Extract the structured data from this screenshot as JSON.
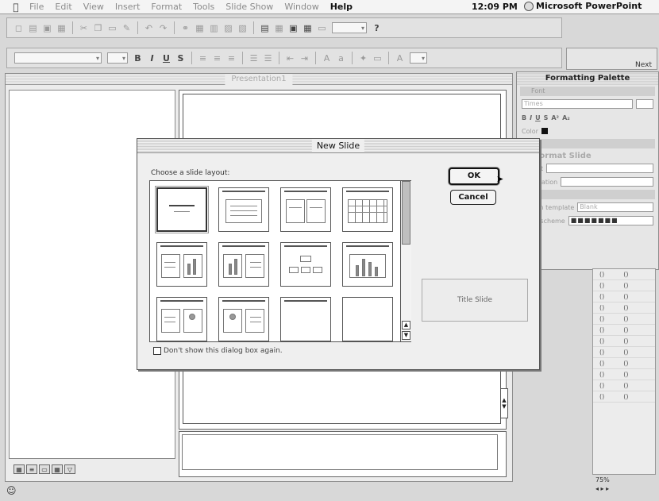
{
  "menubar": {
    "apple": "",
    "items": [
      "File",
      "Edit",
      "View",
      "Insert",
      "Format",
      "Tools",
      "Slide Show",
      "Window",
      "Help"
    ],
    "clock": "12:09 PM",
    "app_name": "Microsoft PowerPoint"
  },
  "document": {
    "title": "Presentation1"
  },
  "palette": {
    "title": "Formatting Palette",
    "font_section": "Font",
    "font_name": "Times",
    "color_label": "Color",
    "placement_heading": "Format Slide",
    "layout_label": "Layout",
    "orientation_label": "Orientation",
    "design_template_label": "Design template",
    "design_template_value": "Blank",
    "color_scheme_label": "Color scheme"
  },
  "next_button": "Next",
  "zoom": "75%",
  "dialog": {
    "title": "New Slide",
    "choose_label": "Choose a slide layout:",
    "ok_label": "OK",
    "cancel_label": "Cancel",
    "preview_label": "Title Slide",
    "checkbox_label": "Don't show this dialog box again.",
    "layouts": [
      "Title Slide",
      "Bulleted List",
      "Two Column Text",
      "Table",
      "Text & Chart",
      "Chart & Text",
      "Organization Chart",
      "Chart",
      "Text & Clip Art",
      "Clip Art & Text",
      "Title Only",
      "Blank"
    ],
    "selected_layout": "Title Slide"
  }
}
